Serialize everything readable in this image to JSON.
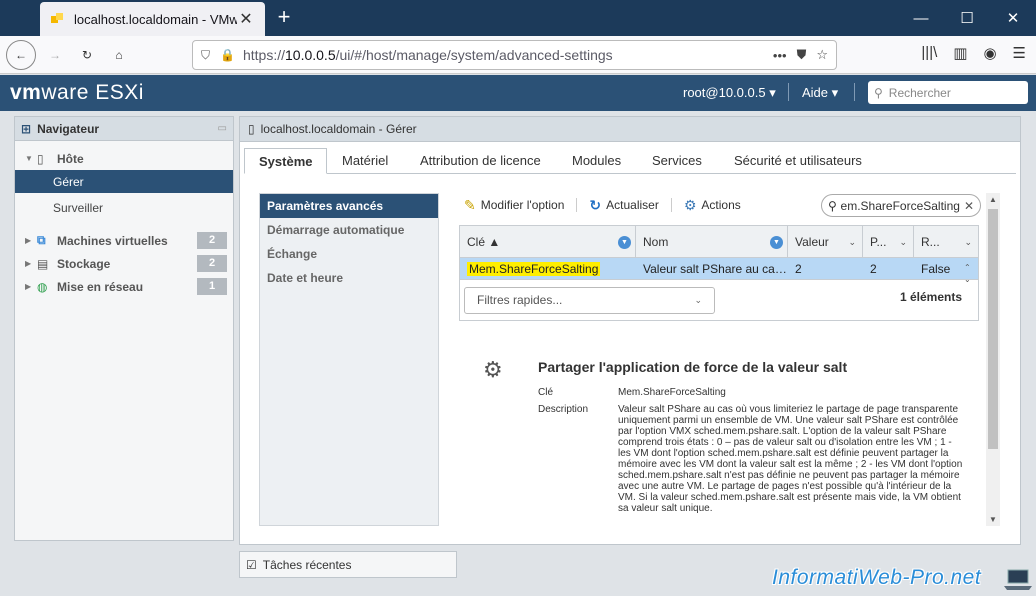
{
  "browser": {
    "tab_title": "localhost.localdomain - VMware ESXi",
    "new_tab": "+",
    "url_prefix": "https://",
    "url_host": "10.0.0.5",
    "url_path": "/ui/#/host/manage/system/advanced-settings",
    "more": "•••"
  },
  "header": {
    "logo_vm": "vm",
    "logo_ware": "ware",
    "logo_product": "ESXi",
    "user": "root@10.0.0.5 ▾",
    "help": "Aide ▾",
    "search_placeholder": "Rechercher"
  },
  "navigator": {
    "title": "Navigateur",
    "host": "Hôte",
    "manage": "Gérer",
    "monitor": "Surveiller",
    "groups": [
      {
        "label": "Machines virtuelles",
        "count": "2"
      },
      {
        "label": "Stockage",
        "count": "2"
      },
      {
        "label": "Mise en réseau",
        "count": "1"
      }
    ]
  },
  "main": {
    "title": "localhost.localdomain - Gérer",
    "tabs": [
      "Système",
      "Matériel",
      "Attribution de licence",
      "Modules",
      "Services",
      "Sécurité et utilisateurs"
    ],
    "left_menu": [
      "Paramètres avancés",
      "Démarrage automatique",
      "Échange",
      "Date et heure"
    ],
    "toolbar": {
      "edit": "Modifier l'option",
      "refresh": "Actualiser",
      "actions": "Actions",
      "search_value": "Mem.ShareForceSalting"
    },
    "grid": {
      "columns": [
        "Clé ▲",
        "Nom",
        "Valeur",
        "P...",
        "R..."
      ],
      "row": [
        "Mem.ShareForceSalting",
        "Valeur salt PShare au cas où vous limiteriez le partage de page",
        "2",
        "2",
        "False"
      ],
      "quick_filters": "Filtres rapides...",
      "count": "1 éléments"
    },
    "detail": {
      "title": "Partager l'application de force de la valeur salt",
      "key_label": "Clé",
      "key_value": "Mem.ShareForceSalting",
      "desc_label": "Description",
      "desc_value": "Valeur salt PShare au cas où vous limiteriez le partage de page transparente uniquement parmi un ensemble de VM. Une valeur salt PShare est contrôlée par l'option VMX sched.mem.pshare.salt. L'option de la valeur salt PShare comprend trois états : 0 – pas de valeur salt ou d'isolation entre les VM ; 1 - les VM dont l'option sched.mem.pshare.salt est définie peuvent partager la mémoire avec les VM dont la valeur salt est la même ; 2 - les VM dont l'option sched.mem.pshare.salt n'est pas définie ne peuvent pas partager la mémoire avec une autre VM. Le partage de pages n'est possible qu'à l'intérieur de la VM. Si la valeur sched.mem.pshare.salt est présente mais vide, la VM obtient sa valeur salt unique."
    }
  },
  "recent_tasks": "Tâches récentes",
  "watermark": "InformatiWeb-Pro.net"
}
